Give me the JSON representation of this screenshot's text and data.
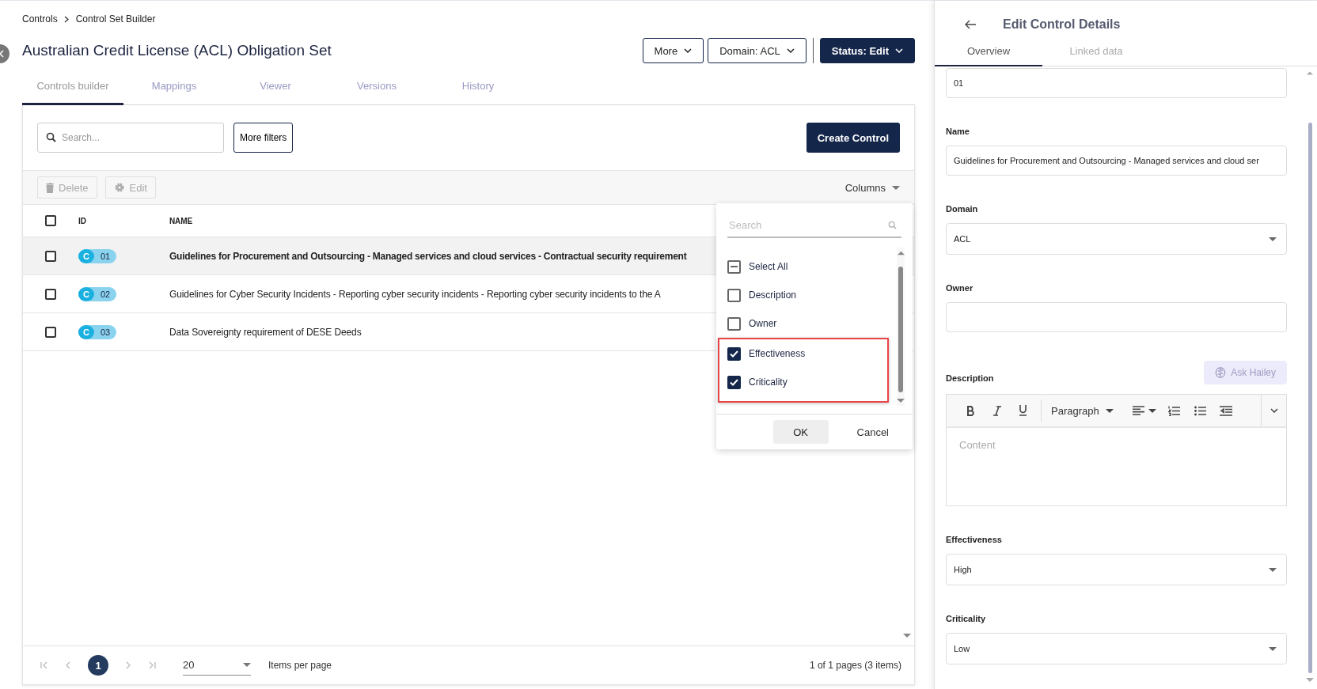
{
  "breadcrumb": [
    {
      "label": "Controls"
    },
    {
      "label": "Control Set Builder"
    }
  ],
  "title": "Australian Credit License (ACL) Obligation Set",
  "header_buttons": [
    {
      "label": "More",
      "kind": "outline"
    },
    {
      "label": "Domain: ACL",
      "kind": "outline"
    },
    {
      "label": "Status: Edit",
      "kind": "primary"
    }
  ],
  "tabs": [
    {
      "label": "Controls builder",
      "selected": true
    },
    {
      "label": "Mappings",
      "selected": false
    },
    {
      "label": "Viewer",
      "selected": false
    },
    {
      "label": "Versions",
      "selected": false
    },
    {
      "label": "History",
      "selected": false
    }
  ],
  "search": {
    "placeholder": "Search..."
  },
  "more_filters": "More filters",
  "create_button": "Create Control",
  "actions": [
    {
      "label": "Delete",
      "kind": "delete",
      "disabled": true
    },
    {
      "label": "Edit",
      "kind": "edit",
      "disabled": true
    }
  ],
  "columns_button": "Columns",
  "table": {
    "all_checked": false,
    "columns": [
      "ID",
      "NAME"
    ],
    "rows": [
      {
        "checked": false,
        "selected": true,
        "badge": "C",
        "id": "01",
        "name": "Guidelines for Procurement and Outsourcing - Managed services and cloud services - Contractual security requirement"
      },
      {
        "checked": false,
        "selected": false,
        "badge": "C",
        "id": "02",
        "name": "Guidelines for Cyber Security Incidents - Reporting cyber security incidents - Reporting cyber security incidents to the A"
      },
      {
        "checked": false,
        "selected": false,
        "badge": "C",
        "id": "03",
        "name": "Data Sovereignty requirement of DESE Deeds"
      }
    ]
  },
  "columns_menu": {
    "search_placeholder": "Search",
    "select_all": {
      "label": "Select All",
      "indeterminate": true
    },
    "options": [
      {
        "label": "Description",
        "checked": false,
        "highlighted": false
      },
      {
        "label": "Owner",
        "checked": false,
        "highlighted": false
      },
      {
        "label": "Effectiveness",
        "checked": true,
        "highlighted": true
      },
      {
        "label": "Criticality",
        "checked": true,
        "highlighted": true
      }
    ],
    "ok": "OK",
    "cancel": "Cancel"
  },
  "pagination": {
    "pages": [
      {
        "label": "1",
        "selected": true
      }
    ],
    "page_size": "20",
    "page_size_label": "Items per page",
    "summary": "1 of 1 pages (3 items)"
  },
  "panel": {
    "title": "Edit Control Details",
    "tabs": [
      {
        "label": "Overview",
        "selected": true
      },
      {
        "label": "Linked data",
        "selected": false
      }
    ],
    "fields": [
      {
        "kind": "text",
        "value": "01"
      },
      {
        "kind": "text",
        "label": "Name",
        "value": "Guidelines for Procurement and Outsourcing - Managed services and cloud ser"
      },
      {
        "kind": "select",
        "label": "Domain",
        "value": "ACL"
      },
      {
        "kind": "text",
        "label": "Owner"
      },
      {
        "kind": "editor",
        "label": "Description",
        "action": "Ask Hailey",
        "block_style": "Paragraph",
        "placeholder": "Content"
      },
      {
        "kind": "select",
        "label": "Effectiveness",
        "value": "High"
      },
      {
        "kind": "select",
        "label": "Criticality",
        "value": "Low"
      }
    ]
  }
}
